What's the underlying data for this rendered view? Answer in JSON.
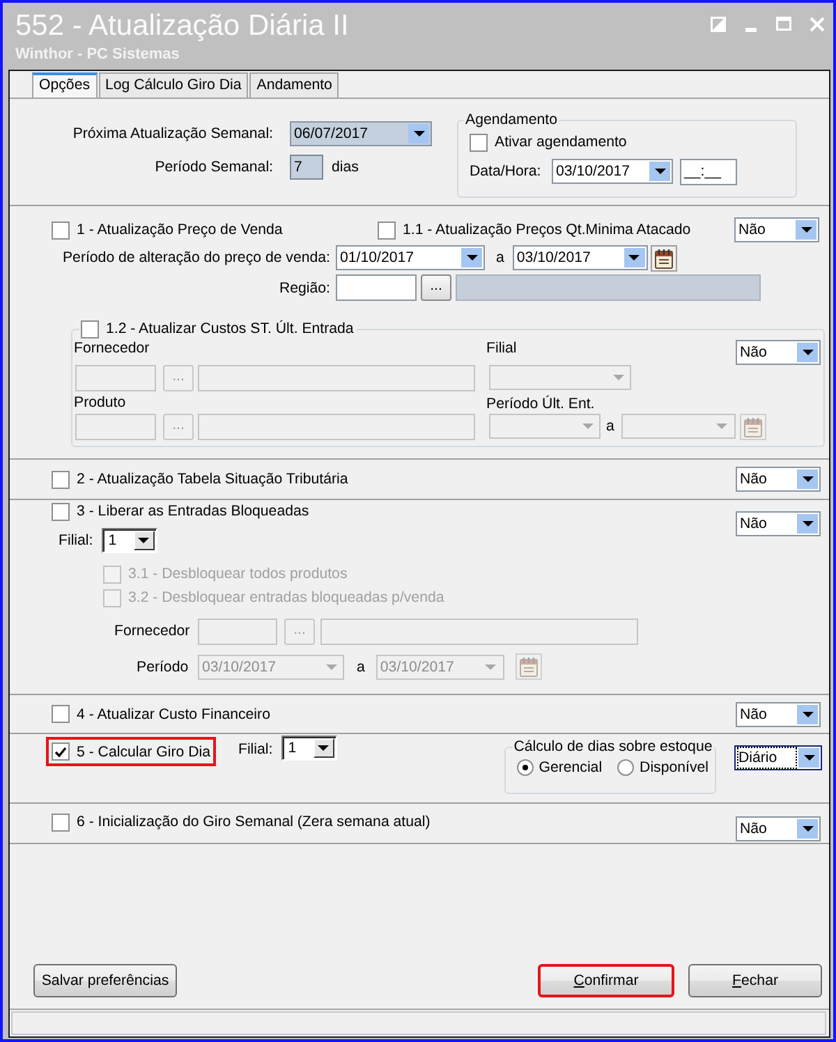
{
  "window": {
    "title": "552 - Atualização Diária II",
    "subtitle": "Winthor - PC Sistemas"
  },
  "tabs": [
    {
      "label": "Opções",
      "selected": true
    },
    {
      "label": "Log Cálculo Giro Dia",
      "selected": false
    },
    {
      "label": "Andamento",
      "selected": false
    }
  ],
  "weekly": {
    "next_update_label": "Próxima Atualização Semanal:",
    "next_update": "06/07/2017",
    "period_label": "Período Semanal:",
    "period": "7",
    "period_unit": "dias"
  },
  "schedule": {
    "title": "Agendamento",
    "enable": {
      "label": "Ativar agendamento",
      "checked": false
    },
    "datetime_label": "Data/Hora:",
    "date": "03/10/2017",
    "time": "__:__"
  },
  "price_update": {
    "options": [
      {
        "label": "1 - Atualização Preço de Venda",
        "checked": false
      },
      {
        "label": "1.1 - Atualização Preços Qt.Minima Atacado",
        "checked": false
      }
    ],
    "select": "Não",
    "period_label": "Período de alteração do preço de venda:",
    "period_from": "01/10/2017",
    "period_to_label": "a",
    "period_to": "03/10/2017",
    "region_label": "Região:",
    "region_lookup": "..."
  },
  "st_costs": {
    "option": {
      "label": "1.2 - Atualizar Custos ST. Últ. Entrada",
      "checked": false
    },
    "select": "Não",
    "fields_disabled": true,
    "supplier_label": "Fornecedor",
    "supplier_lookup": "...",
    "branch_label": "Filial",
    "product_label": "Produto",
    "product_lookup": "...",
    "period_label": "Período Últ. Ent.",
    "period_to_label": "a"
  },
  "tax_table": {
    "option": {
      "label": "2 - Atualização Tabela Situação Tributária",
      "checked": false
    },
    "select": "Não"
  },
  "blocked_entries": {
    "option": {
      "label": "3 - Liberar as Entradas Bloqueadas",
      "checked": false
    },
    "select": "Não",
    "branch_label": "Filial:",
    "branch": "1",
    "sub_options": [
      {
        "label": "3.1 - Desbloquear todos produtos",
        "checked": false,
        "disabled": true
      },
      {
        "label": "3.2 - Desbloquear entradas bloqueadas p/venda",
        "checked": false,
        "disabled": true
      }
    ],
    "fields_disabled": true,
    "supplier_label": "Fornecedor",
    "supplier_lookup": "...",
    "period_label": "Período",
    "period_from": "03/10/2017",
    "period_to_label": "a",
    "period_to": "03/10/2017"
  },
  "financial_cost": {
    "option": {
      "label": "4 - Atualizar Custo Financeiro",
      "checked": false
    },
    "select": "Não"
  },
  "daily_turnover": {
    "option": {
      "label": "5 - Calcular Giro Dia",
      "checked": true,
      "highlighted": true
    },
    "branch_label": "Filial:",
    "branch": "1",
    "stock_days": {
      "title": "Cálculo de dias sobre estoque",
      "options": [
        {
          "label": "Gerencial",
          "selected": true
        },
        {
          "label": "Disponível",
          "selected": false
        }
      ]
    },
    "select": "Diário",
    "select_focused": true
  },
  "weekly_reset": {
    "option": {
      "label": "6 - Inicialização do Giro Semanal (Zera semana atual)",
      "checked": false
    },
    "select": "Não"
  },
  "buttons": [
    {
      "label": "Salvar preferências",
      "mnemonic": false,
      "highlighted": false
    },
    {
      "label": "Confirmar",
      "mnemonic": true,
      "highlighted": true
    },
    {
      "label": "Fechar",
      "mnemonic": true,
      "highlighted": false
    }
  ]
}
